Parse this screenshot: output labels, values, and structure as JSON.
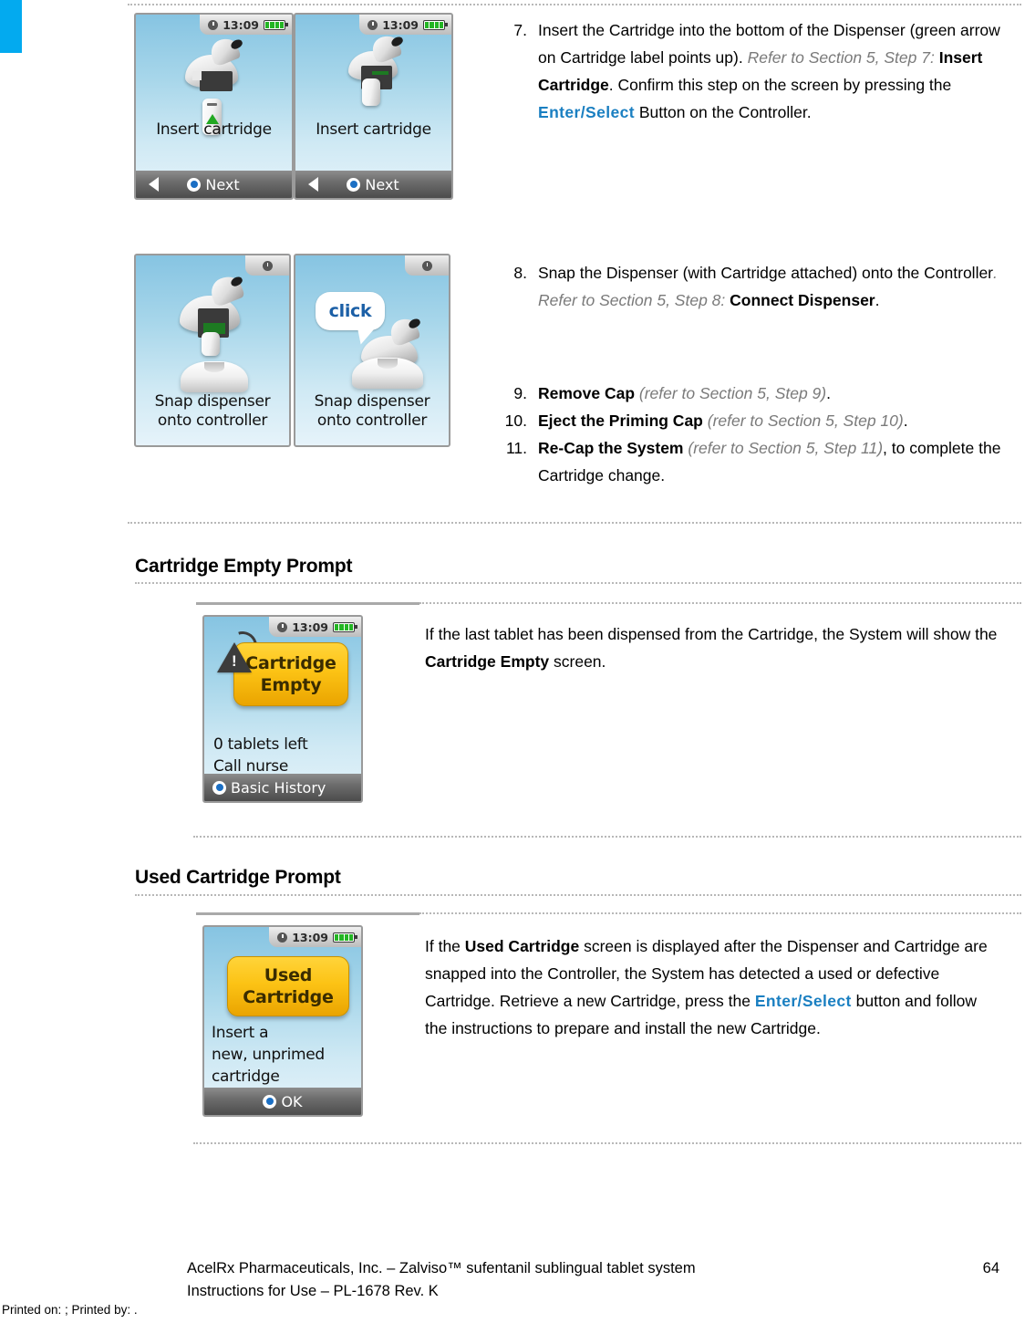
{
  "page": {
    "page_number": "64",
    "marker_color": "#03aaef"
  },
  "steps": [
    {
      "num": "7.",
      "parts": [
        {
          "t": "Insert the Cartridge into the bottom of the Dispenser (green arrow on Cartridge label points up).  ",
          "s": "plain"
        },
        {
          "t": "Refer to Section 5, Step 7: ",
          "s": "italic-gray"
        },
        {
          "t": "Insert Cartridge",
          "s": "bold"
        },
        {
          "t": ".  Confirm this step on the screen by pressing the ",
          "s": "plain"
        },
        {
          "t": "Enter/Select",
          "s": "enterselect"
        },
        {
          "t": " Button on the Controller.",
          "s": "plain"
        }
      ]
    },
    {
      "num": "8.",
      "parts": [
        {
          "t": "Snap the Dispenser (with Cartridge attached) onto the Controller",
          "s": "plain"
        },
        {
          "t": ". Refer to Section 5, Step 8: ",
          "s": "italic-gray"
        },
        {
          "t": "Connect Dispenser",
          "s": "bold"
        },
        {
          "t": ".",
          "s": "plain"
        }
      ]
    },
    {
      "num": "9.",
      "parts": [
        {
          "t": "Remove Cap",
          "s": "bold"
        },
        {
          "t": " (refer to Section 5, Step 9)",
          "s": "italic-gray"
        },
        {
          "t": ".",
          "s": "plain"
        }
      ]
    },
    {
      "num": "10.",
      "parts": [
        {
          "t": "Eject the Priming Cap",
          "s": "bold"
        },
        {
          "t": " (refer to Section 5, Step 10)",
          "s": "italic-gray"
        },
        {
          "t": ".",
          "s": "plain"
        }
      ]
    },
    {
      "num": "11.",
      "parts": [
        {
          "t": "Re-Cap the System",
          "s": "bold"
        },
        {
          "t": " (refer to Section 5, Step 11)",
          "s": "italic-gray"
        },
        {
          "t": ", to complete the Cartridge change.",
          "s": "plain"
        }
      ]
    }
  ],
  "device_screens": {
    "insert_cartridge_a": {
      "time": "13:09",
      "caption": "Insert cartridge",
      "softkey_label": "Next"
    },
    "insert_cartridge_b": {
      "time": "13:09",
      "caption": "Insert cartridge",
      "softkey_label": "Next"
    },
    "snap_dispenser_a": {
      "caption_line1": "Snap dispenser",
      "caption_line2": "onto controller"
    },
    "snap_dispenser_b": {
      "bubble_text": "click",
      "caption_line1": "Snap dispenser",
      "caption_line2": "onto controller"
    },
    "cartridge_empty": {
      "time": "13:09",
      "alert_line1": "Cartridge",
      "alert_line2": "Empty",
      "body_line1": "0 tablets left",
      "body_line2": "Call nurse",
      "softkey_label": "Basic History"
    },
    "used_cartridge": {
      "time": "13:09",
      "alert_line1": "Used",
      "alert_line2": "Cartridge",
      "body_line1": "Insert a",
      "body_line2": "new, unprimed",
      "body_line3": "cartridge",
      "softkey_label": "OK"
    }
  },
  "sections": [
    {
      "id": "cartridge-empty",
      "heading": "Cartridge Empty Prompt",
      "paragraph": [
        {
          "t": "If the last tablet has been dispensed from the Cartridge, the System will show the ",
          "s": "plain"
        },
        {
          "t": "Cartridge Empty",
          "s": "bold"
        },
        {
          "t": " screen.",
          "s": "plain"
        }
      ]
    },
    {
      "id": "used-cartridge",
      "heading": "Used Cartridge Prompt",
      "paragraph": [
        {
          "t": "If the ",
          "s": "plain"
        },
        {
          "t": "Used Cartridge",
          "s": "bold"
        },
        {
          "t": " screen is displayed after the Dispenser and Cartridge are snapped into the Controller, the System has detected a used or defective Cartridge.  Retrieve a new Cartridge, press the ",
          "s": "plain"
        },
        {
          "t": "Enter/Select",
          "s": "enterselect"
        },
        {
          "t": " button and follow the instructions to prepare and install the new Cartridge.",
          "s": "plain"
        }
      ]
    }
  ],
  "footer": {
    "line1": "AcelRx Pharmaceuticals, Inc. – Zalviso™ sufentanil sublingual tablet system",
    "line2": "Instructions for Use – PL-1678 Rev. K",
    "page_number": "64",
    "printed": "Printed on: ; Printed by: ."
  }
}
